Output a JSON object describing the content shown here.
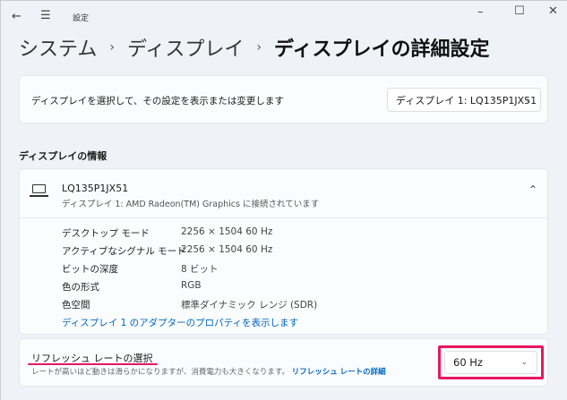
{
  "titlebar": {
    "app_title": "設定",
    "back_icon": "arrow-left-icon",
    "menu_icon": "hamburger-icon"
  },
  "window_controls": {
    "minimize": "–",
    "maximize": "☐",
    "close": "✕"
  },
  "breadcrumb": [
    {
      "label": "システム"
    },
    {
      "label": "ディスプレイ"
    },
    {
      "label": "ディスプレイの詳細設定"
    }
  ],
  "select_display": {
    "label": "ディスプレイを選択して、その設定を表示または変更します",
    "value": "ディスプレイ 1: LQ135P1JX51"
  },
  "section_title": "ディスプレイの情報",
  "display_info": {
    "name": "LQ135P1JX51",
    "subtitle": "ディスプレイ 1: AMD Radeon(TM) Graphics に接続されています",
    "rows": [
      {
        "label": "デスクトップ モード",
        "value": "2256 × 1504 60 Hz"
      },
      {
        "label": "アクティブなシグナル モード",
        "value": "2256 × 1504 60 Hz"
      },
      {
        "label": "ビットの深度",
        "value": "8 ビット"
      },
      {
        "label": "色の形式",
        "value": "RGB"
      },
      {
        "label": "色空間",
        "value": "標準ダイナミック レンジ (SDR)"
      }
    ],
    "link": "ディスプレイ 1 のアダプターのプロパティを表示します"
  },
  "refresh": {
    "title": "リフレッシュ レートの選択",
    "description": "レートが高いほど動きは滑らかになりますが、消費電力も大きくなります。",
    "link": "リフレッシュ レートの詳細",
    "value": "60 Hz"
  },
  "colors": {
    "accent": "#0067c0",
    "highlight": "#e8175d"
  }
}
